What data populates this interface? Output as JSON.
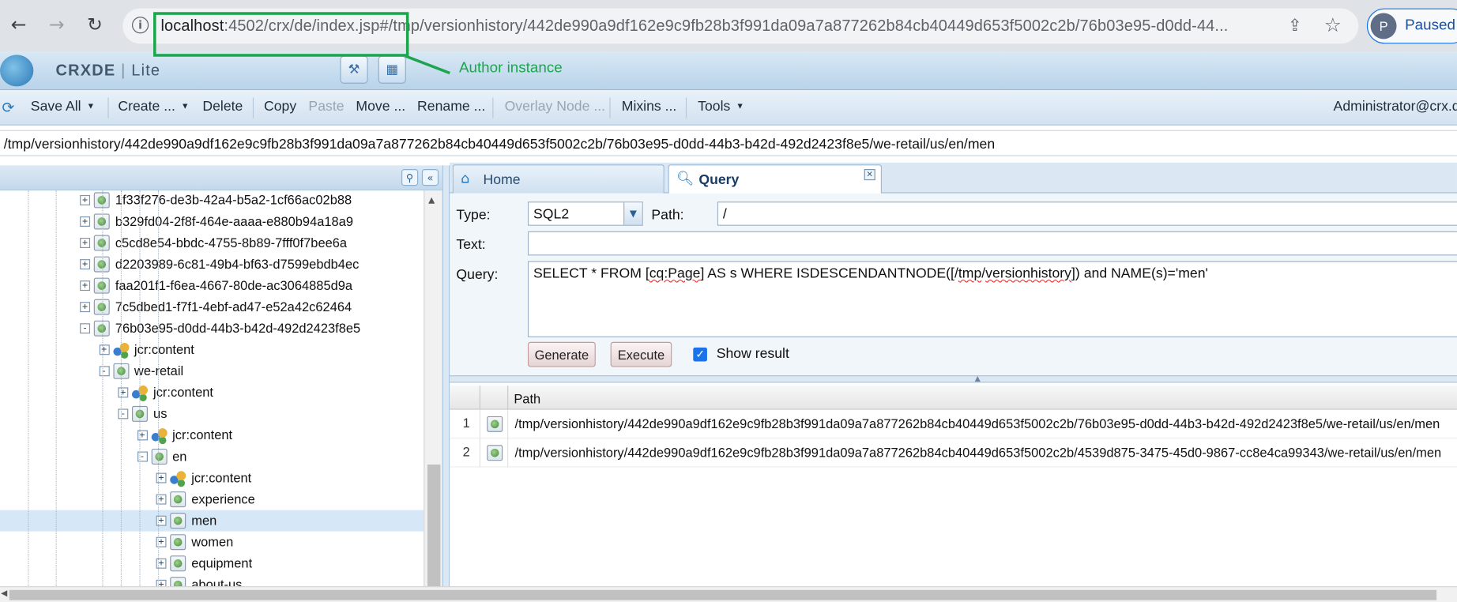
{
  "browser": {
    "url_host": "localhost",
    "url_rest": ":4502/crx/de/index.jsp#/tmp/versionhistory/442de990a9df162e9c9fb28b3f991da09a7a877262b84cb40449d653f5002c2b/76b03e95-d0dd-44...",
    "profile_initial": "P",
    "profile_status": "Paused"
  },
  "annotation": {
    "label": "Author instance",
    "color": "#1da54e"
  },
  "app": {
    "title_bold": "CRXDE",
    "title_sep": "|",
    "title_light": "Lite"
  },
  "toolbar": {
    "save_all": "Save All",
    "create": "Create ...",
    "delete": "Delete",
    "copy": "Copy",
    "paste": "Paste",
    "move": "Move ...",
    "rename": "Rename ...",
    "overlay": "Overlay Node ...",
    "mixins": "Mixins ...",
    "tools": "Tools",
    "user": "Administrator@crx.de"
  },
  "current_path": "/tmp/versionhistory/442de990a9df162e9c9fb28b3f991da09a7a877262b84cb40449d653f5002c2b/76b03e95-d0dd-44b3-b42d-492d2423f8e5/we-retail/us/en/men",
  "tree": [
    {
      "label": "1f33f276-de3b-42a4-b5a2-1cf66ac02b88",
      "depth": 0,
      "icon": "page",
      "expander": "+"
    },
    {
      "label": "b329fd04-2f8f-464e-aaaa-e880b94a18a9",
      "depth": 0,
      "icon": "page",
      "expander": "+"
    },
    {
      "label": "c5cd8e54-bbdc-4755-8b89-7fff0f7bee6a",
      "depth": 0,
      "icon": "page",
      "expander": "+"
    },
    {
      "label": "d2203989-6c81-49b4-bf63-d7599ebdb4ec",
      "depth": 0,
      "icon": "page",
      "expander": "+"
    },
    {
      "label": "faa201f1-f6ea-4667-80de-ac3064885d9a",
      "depth": 0,
      "icon": "page",
      "expander": "+"
    },
    {
      "label": "7c5dbed1-f7f1-4ebf-ad47-e52a42c62464",
      "depth": 0,
      "icon": "page",
      "expander": "+"
    },
    {
      "label": "76b03e95-d0dd-44b3-b42d-492d2423f8e5",
      "depth": 0,
      "icon": "page",
      "expander": "-"
    },
    {
      "label": "jcr:content",
      "depth": 1,
      "icon": "content",
      "expander": "+"
    },
    {
      "label": "we-retail",
      "depth": 1,
      "icon": "page",
      "expander": "-"
    },
    {
      "label": "jcr:content",
      "depth": 2,
      "icon": "content",
      "expander": "+"
    },
    {
      "label": "us",
      "depth": 2,
      "icon": "page",
      "expander": "-"
    },
    {
      "label": "jcr:content",
      "depth": 3,
      "icon": "content",
      "expander": "+"
    },
    {
      "label": "en",
      "depth": 3,
      "icon": "page",
      "expander": "-"
    },
    {
      "label": "jcr:content",
      "depth": 4,
      "icon": "content",
      "expander": "+"
    },
    {
      "label": "experience",
      "depth": 4,
      "icon": "page",
      "expander": "+"
    },
    {
      "label": "men",
      "depth": 4,
      "icon": "page",
      "expander": "+",
      "selected": true
    },
    {
      "label": "women",
      "depth": 4,
      "icon": "page",
      "expander": "+"
    },
    {
      "label": "equipment",
      "depth": 4,
      "icon": "page",
      "expander": "+"
    },
    {
      "label": "about-us",
      "depth": 4,
      "icon": "page",
      "expander": "+"
    }
  ],
  "tabs": {
    "home": "Home",
    "query": "Query"
  },
  "query_form": {
    "type_label": "Type:",
    "type_value": "SQL2",
    "path_label": "Path:",
    "path_value": "/",
    "text_label": "Text:",
    "text_value": "",
    "query_label": "Query:",
    "query_part1": "SELECT * FROM [",
    "query_part2": "cq:Page",
    "query_part3": "] AS s WHERE ISDESCENDANTNODE([/",
    "query_part4": "tmp",
    "query_part5": "/",
    "query_part6": "versionhistory",
    "query_part7": "]) and NAME(s)='men'",
    "generate": "Generate",
    "execute": "Execute",
    "show_result": "Show result",
    "show_result_checked": true
  },
  "results": {
    "header_path": "Path",
    "rows": [
      {
        "num": "1",
        "path": "/tmp/versionhistory/442de990a9df162e9c9fb28b3f991da09a7a877262b84cb40449d653f5002c2b/76b03e95-d0dd-44b3-b42d-492d2423f8e5/we-retail/us/en/men"
      },
      {
        "num": "2",
        "path": "/tmp/versionhistory/442de990a9df162e9c9fb28b3f991da09a7a877262b84cb40449d653f5002c2b/4539d875-3475-45d0-9867-cc8e4ca99343/we-retail/us/en/men"
      }
    ]
  }
}
